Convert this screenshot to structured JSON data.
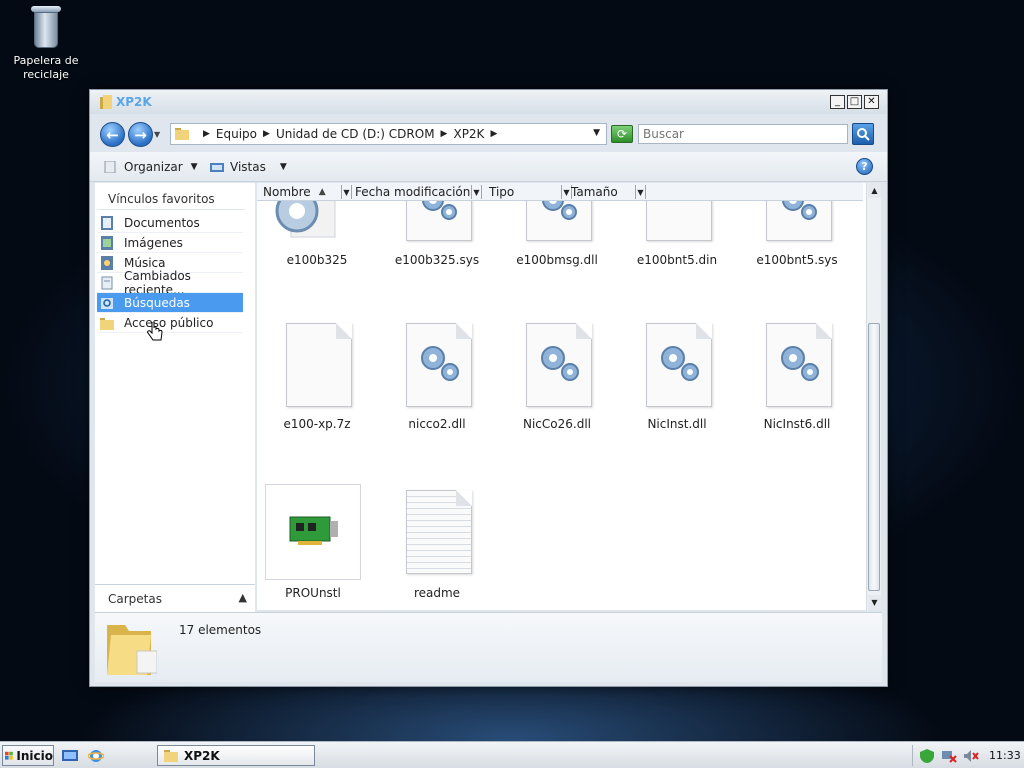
{
  "desktop": {
    "recycle_bin_label_line1": "Papelera de",
    "recycle_bin_label_line2": "reciclaje"
  },
  "window": {
    "title": "XP2K",
    "controls": {
      "minimize": "_",
      "maximize": "□",
      "close": "✕"
    }
  },
  "address": {
    "breadcrumbs": [
      "Equipo",
      "Unidad de CD (D:) CDROM",
      "XP2K"
    ],
    "search_placeholder": "Buscar"
  },
  "toolbar": {
    "organize_label": "Organizar",
    "views_label": "Vistas",
    "help_label": "?"
  },
  "nav_pane": {
    "header": "Vínculos favoritos",
    "items": [
      {
        "label": "Documentos",
        "icon": "documents-icon",
        "selected": false
      },
      {
        "label": "Imágenes",
        "icon": "pictures-icon",
        "selected": false
      },
      {
        "label": "Música",
        "icon": "music-icon",
        "selected": false
      },
      {
        "label": "Cambiados reciente...",
        "icon": "recent-icon",
        "selected": false
      },
      {
        "label": "Búsquedas",
        "icon": "search-folder-icon",
        "selected": true
      },
      {
        "label": "Acceso público",
        "icon": "public-folder-icon",
        "selected": false
      }
    ],
    "folders_label": "Carpetas"
  },
  "columns": [
    "Nombre",
    "Fecha modificación",
    "Tipo",
    "Tamaño"
  ],
  "files": [
    {
      "name": "e100b325",
      "icon": "gear-app-icon"
    },
    {
      "name": "e100b325.sys",
      "icon": "system-file-icon"
    },
    {
      "name": "e100bmsg.dll",
      "icon": "system-file-icon"
    },
    {
      "name": "e100bnt5.din",
      "icon": "blank-file-icon"
    },
    {
      "name": "e100bnt5.sys",
      "icon": "system-file-icon"
    },
    {
      "name": "e100-xp.7z",
      "icon": "blank-file-icon"
    },
    {
      "name": "nicco2.dll",
      "icon": "system-file-icon"
    },
    {
      "name": "NicCo26.dll",
      "icon": "system-file-icon"
    },
    {
      "name": "NicInst.dll",
      "icon": "system-file-icon"
    },
    {
      "name": "NicInst6.dll",
      "icon": "system-file-icon"
    },
    {
      "name": "PROUnstl",
      "icon": "network-card-icon"
    },
    {
      "name": "readme",
      "icon": "text-file-icon"
    }
  ],
  "details": {
    "count_text": "17 elementos"
  },
  "taskbar": {
    "start_label": "Inicio",
    "task_label": "XP2K",
    "clock": "11:33"
  },
  "colors": {
    "selection": "#4a9bef",
    "title_text": "#59a6e6"
  }
}
